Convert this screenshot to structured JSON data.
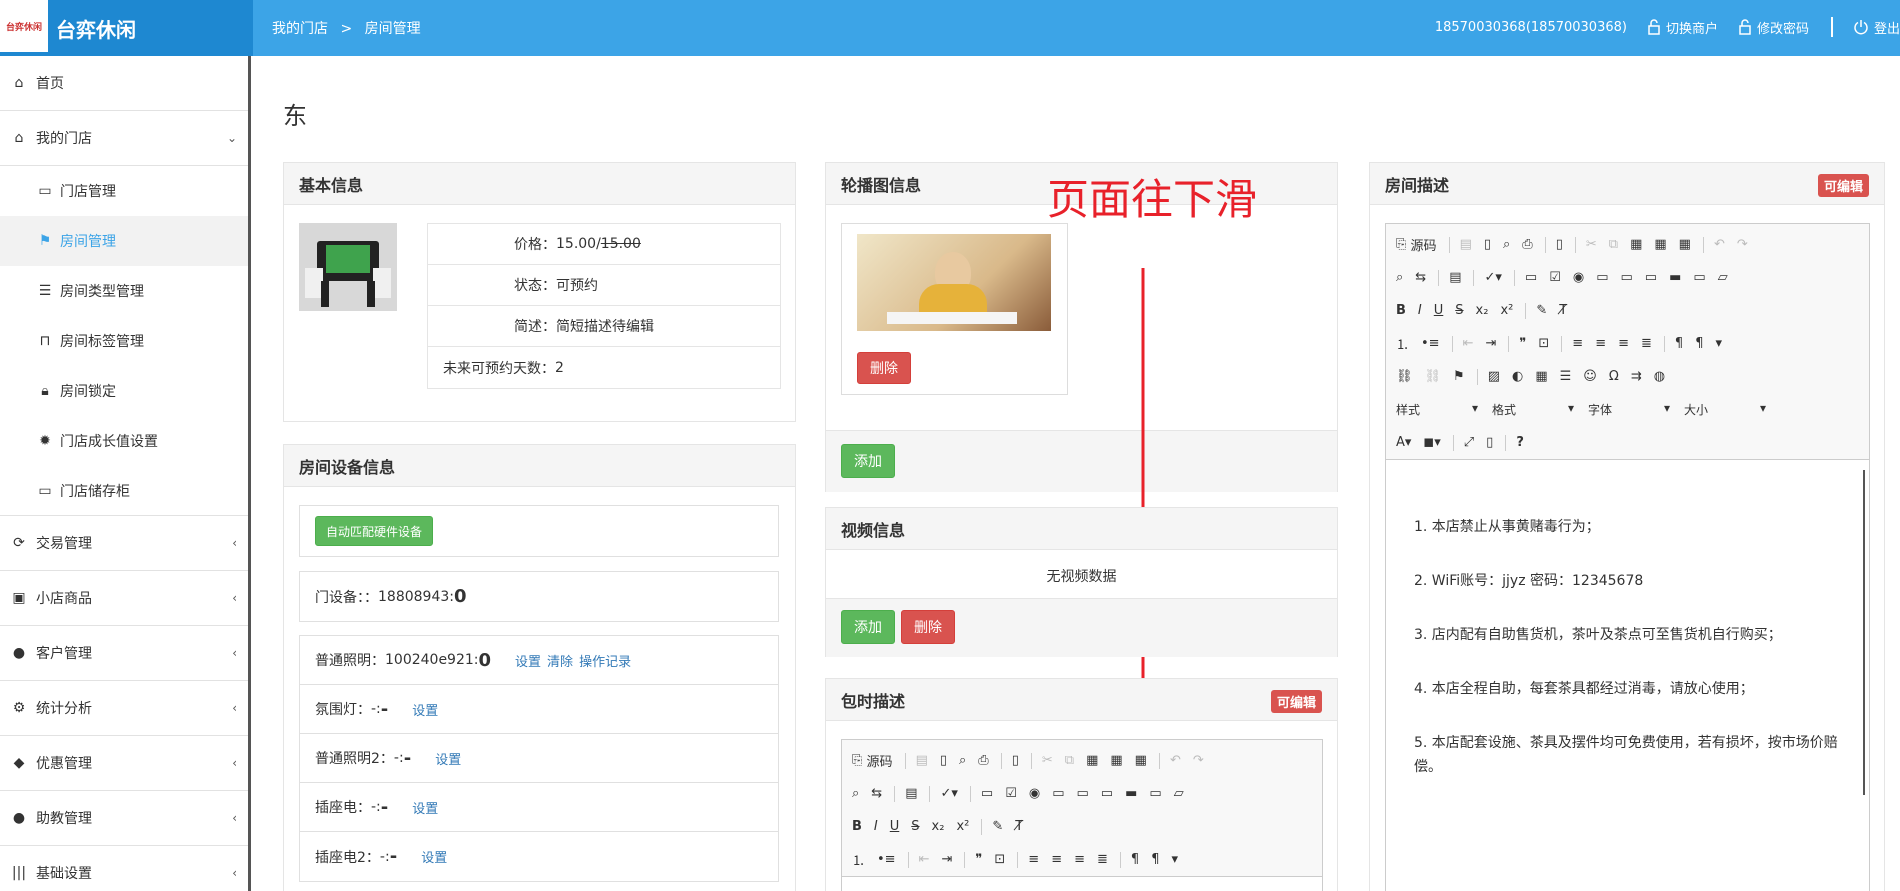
{
  "header": {
    "logo_text": "台弈休闲",
    "logo_mark": "台弈休闲",
    "breadcrumb": [
      "我的门店",
      ">",
      "房间管理"
    ],
    "account": "18570030368(18570030368)",
    "switch_merchant": "切换商户",
    "change_password": "修改密码",
    "logout": "登出"
  },
  "sidebar": {
    "items": [
      {
        "label": "首页",
        "icon": "home-icon"
      },
      {
        "label": "我的门店",
        "icon": "home-icon",
        "chev": "⌄"
      },
      {
        "label": "交易管理",
        "icon": "refresh-icon",
        "chev": "‹"
      },
      {
        "label": "小店商品",
        "icon": "gift-icon",
        "chev": "‹"
      },
      {
        "label": "客户管理",
        "icon": "user-icon",
        "chev": "‹"
      },
      {
        "label": "统计分析",
        "icon": "gear-icon",
        "chev": "‹"
      },
      {
        "label": "优惠管理",
        "icon": "tags-icon",
        "chev": "‹"
      },
      {
        "label": "助教管理",
        "icon": "user-icon",
        "chev": "‹"
      },
      {
        "label": "基础设置",
        "icon": "barcode-icon",
        "chev": "‹"
      }
    ],
    "subitems": [
      {
        "label": "门店管理"
      },
      {
        "label": "房间管理"
      },
      {
        "label": "房间类型管理"
      },
      {
        "label": "房间标签管理"
      },
      {
        "label": "房间锁定"
      },
      {
        "label": "门店成长值设置"
      },
      {
        "label": "门店储存柜"
      }
    ]
  },
  "page_title": "东",
  "basic": {
    "title": "基本信息",
    "price_label": "价格：",
    "price": "15.00/",
    "price_old": "15.00",
    "status_label": "状态：",
    "status": "可预约",
    "desc_label": "简述：",
    "desc": "简短描述待编辑",
    "days_label": "未来可预约天数：",
    "days": "2"
  },
  "devices": {
    "title": "房间设备信息",
    "auto_match": "自动匹配硬件设备",
    "door_label": "门设备：：",
    "door_id": "18808943:",
    "door_val": "0",
    "rows": [
      {
        "label": "普通照明：",
        "id": "100240e921:",
        "val": "0",
        "links": [
          "设置",
          "清除",
          "操作记录"
        ]
      },
      {
        "label": "氛围灯：",
        "id": "-:",
        "val": "-",
        "links": [
          "设置"
        ]
      },
      {
        "label": "普通照明2：",
        "id": "-:",
        "val": "-",
        "links": [
          "设置"
        ]
      },
      {
        "label": "插座电：",
        "id": "-:",
        "val": "-",
        "links": [
          "设置"
        ]
      },
      {
        "label": "插座电2：",
        "id": "-:",
        "val": "-",
        "links": [
          "设置"
        ]
      }
    ]
  },
  "carousel": {
    "title": "轮播图信息",
    "delete": "删除",
    "add": "添加"
  },
  "annotation": "页面往下滑",
  "video": {
    "title": "视频信息",
    "empty": "无视频数据",
    "add": "添加",
    "delete": "删除"
  },
  "package": {
    "title": "包时描述",
    "badge": "可编辑"
  },
  "room_desc": {
    "title": "房间描述",
    "badge": "可编辑",
    "lines": [
      "1. 本店禁止从事黄赌毒行为；",
      "2. WiFi账号：jjyz 密码：12345678",
      "3. 店内配有自助售货机，茶叶及茶点可至售货机自行购买；",
      "4. 本店全程自助，每套茶具都经过消毒，请放心使用；",
      "5. 本店配套设施、茶具及摆件均可免费使用，若有损坏，按市场价赔偿。"
    ]
  },
  "editor": {
    "source": "源码",
    "style": "样式",
    "format": "格式",
    "font": "字体",
    "size": "大小"
  },
  "colors": {
    "header": "#3ca4e7",
    "logo_bg": "#1e88d1",
    "active": "#3ca4e7",
    "danger": "#d9534f",
    "success": "#5cb85c",
    "arrow": "#e8212a"
  }
}
